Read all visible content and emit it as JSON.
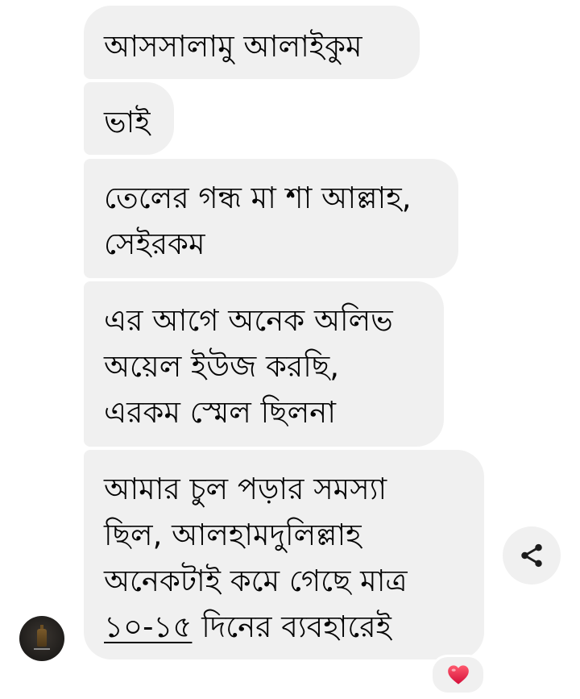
{
  "messages": [
    {
      "lines": [
        "আসসালামু আলাইকুম"
      ]
    },
    {
      "lines": [
        "ভাই"
      ]
    },
    {
      "lines": [
        "তেলের গন্ধ মা শা আল্লাহ,",
        "সেইরকম"
      ]
    },
    {
      "lines": [
        "এর আগে অনেক অলিভ",
        "অয়েল ইউজ করছি,",
        "এরকম স্মেল ছিলনা"
      ]
    },
    {
      "lines": [
        "আমার চুল পড়ার সমস্যা",
        "ছিল, আলহামদুলিল্লাহ",
        "অনেকটাই কমে গেছে মাত্র"
      ],
      "last_line_underlined": "১০-১৫",
      "last_line_rest": " দিনের ব্যবহারেই"
    }
  ],
  "share_icon": "share-icon",
  "reaction": {
    "icon": "heart-icon",
    "color": "#e0245e"
  },
  "avatar_icon": "oil-bottle-avatar",
  "colors": {
    "bubble": "#f0f0f0",
    "text": "#050505"
  }
}
